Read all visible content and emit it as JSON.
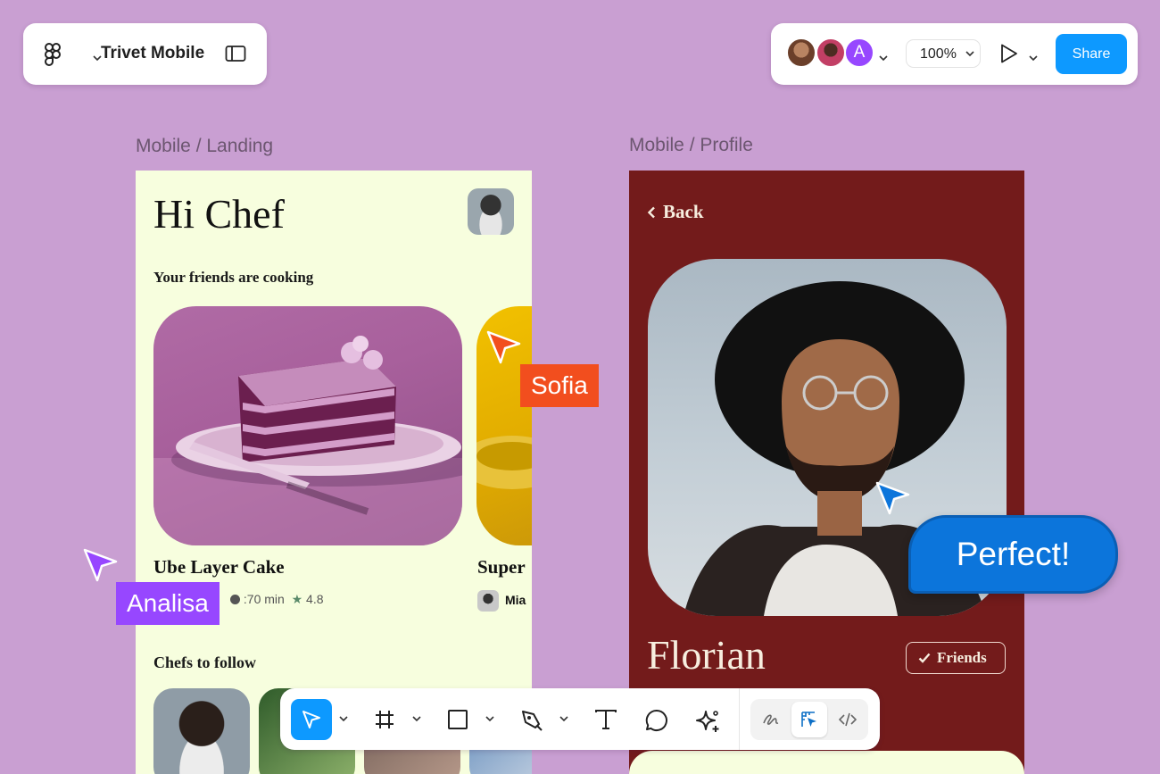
{
  "file": {
    "name": "Trivet Mobile"
  },
  "header": {
    "zoom": "100%",
    "share_label": "Share",
    "collaborator_initial": "A",
    "colors": {
      "accent": "#0d99ff",
      "canvas": "#c99fd2"
    }
  },
  "frames": {
    "landing": {
      "label": "Mobile / Landing",
      "greeting": "Hi Chef",
      "section_title": "Your friends are cooking",
      "cards": [
        {
          "title": "Ube Layer Cake",
          "time": ":70 min",
          "rating": "4.8"
        },
        {
          "title": "Super",
          "author": "Mia"
        }
      ],
      "chefs_title": "Chefs to follow"
    },
    "profile": {
      "label": "Mobile / Profile",
      "back_label": "Back",
      "name": "Florian",
      "friends_label": "Friends",
      "background_color": "#731b1b"
    }
  },
  "cursors": {
    "sofia": {
      "name": "Sofia",
      "color": "#f24e1e"
    },
    "analisa": {
      "name": "Analisa",
      "color": "#9747ff"
    },
    "comment": {
      "text": "Perfect!",
      "color": "#0c75db"
    }
  },
  "toolbar": {
    "tools": [
      "move-tool",
      "frame-tool",
      "rectangle-tool",
      "pen-tool",
      "text-tool",
      "comment-tool",
      "actions-tool"
    ],
    "modes": [
      "draw-mode",
      "design-mode",
      "dev-mode"
    ],
    "selected_tool": "move-tool",
    "selected_mode": "design-mode"
  }
}
